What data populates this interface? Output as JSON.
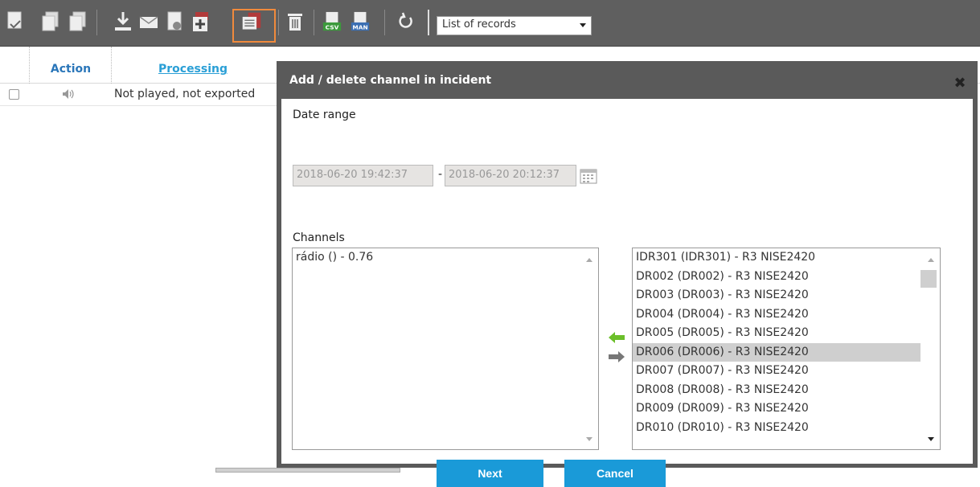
{
  "toolbar": {
    "icons": [
      "export-down-icon",
      "copy-doc-icon",
      "copy-doc-2-icon",
      "download-icon",
      "mail-icon",
      "doc-settings-icon",
      "add-incident-icon",
      "channel-incident-icon",
      "trash-icon",
      "csv-export-icon",
      "man-export-icon",
      "refresh-icon"
    ],
    "view_select": {
      "value": "List of records"
    },
    "highlight_color": "#f08a3c"
  },
  "grid": {
    "headers": {
      "action": "Action",
      "processing": "Processing"
    },
    "rows": [
      {
        "status": "Not played, not exported"
      }
    ]
  },
  "dialog": {
    "title": "Add / delete channel in incident",
    "date_range_label": "Date range",
    "date_from": "2018-06-20 19:42:37",
    "date_separator": "-",
    "date_to": "2018-06-20 20:12:37",
    "channels_label": "Channels",
    "selected_channels": [
      "rádio () - 0.76"
    ],
    "available_channels": [
      "IDR301 (IDR301) - R3 NISE2420",
      "DR002 (DR002) - R3 NISE2420",
      "DR003 (DR003) - R3 NISE2420",
      "DR004 (DR004) - R3 NISE2420",
      "DR005 (DR005) - R3 NISE2420",
      "DR006 (DR006) - R3 NISE2420",
      "DR007 (DR007) - R3 NISE2420",
      "DR008 (DR008) - R3 NISE2420",
      "DR009 (DR009) - R3 NISE2420",
      "DR010 (DR010) - R3 NISE2420"
    ],
    "selected_index": 5,
    "next_label": "Next",
    "cancel_label": "Cancel",
    "accent_color": "#1a9ad8"
  }
}
